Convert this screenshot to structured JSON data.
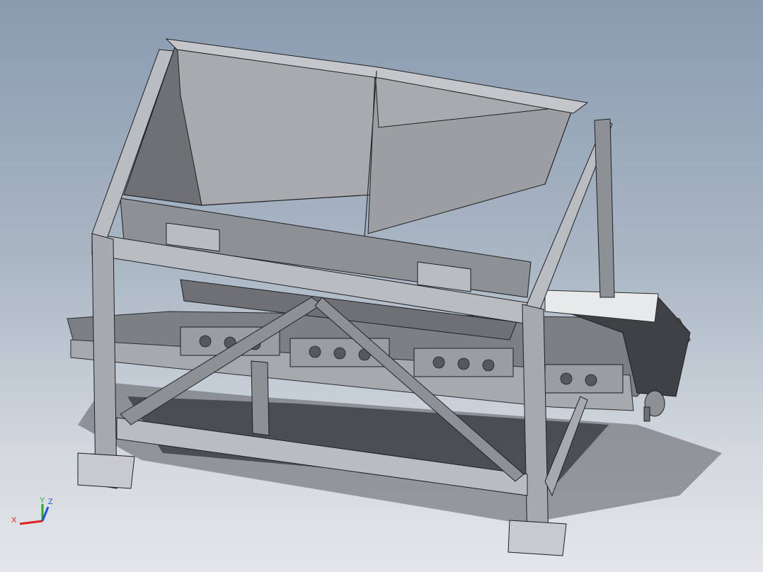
{
  "viewport": {
    "background_top": "#8a9bb0",
    "background_bottom": "#e4e6e9",
    "model_name": ""
  },
  "triad": {
    "x_label": "X",
    "y_label": "Y",
    "z_label": "Z",
    "x_color": "#e02020",
    "y_color": "#20b020",
    "z_color": "#2050e0"
  },
  "colors": {
    "steel_light": "#b9bcc0",
    "steel_mid": "#8d9095",
    "steel_dark": "#5e6166",
    "hopper_inner_light": "#a8aaad",
    "hopper_inner_dark": "#6e7073",
    "belt": "#3f4145",
    "shadow": "#2e3034"
  }
}
